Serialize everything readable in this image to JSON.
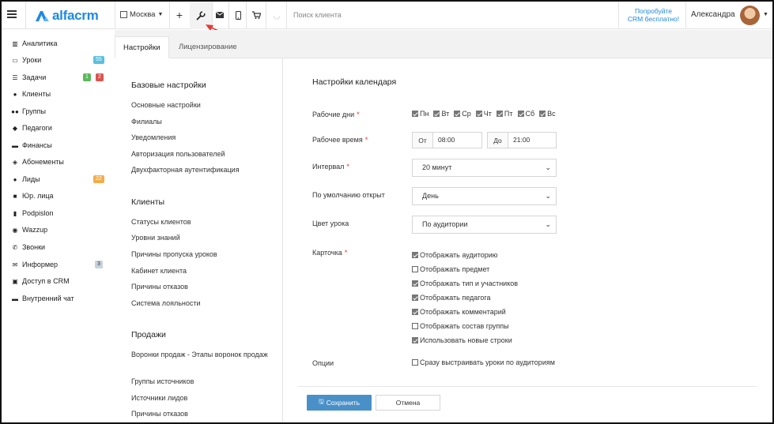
{
  "header": {
    "logo_text": "alfacrm",
    "branch": "Москва",
    "search_placeholder": "Поиск клиента",
    "promo_line1": "Попробуйте",
    "promo_line2": "CRM бесплатно!",
    "user_name": "Александра",
    "icons": [
      "menu-icon",
      "plus-icon",
      "wrench-icon",
      "envelope-icon",
      "mobile-icon",
      "cart-icon"
    ]
  },
  "sidebar": {
    "items": [
      {
        "label": "Аналитика",
        "icon": "chart-icon"
      },
      {
        "label": "Уроки",
        "icon": "calendar-icon",
        "badge": "55",
        "badge_color": "#5bc0de"
      },
      {
        "label": "Задачи",
        "icon": "tasks-icon",
        "badge": "1",
        "badge_color": "#5cb85c",
        "badge2": "2",
        "badge2_color": "#d9534f"
      },
      {
        "label": "Клиенты",
        "icon": "user-icon"
      },
      {
        "label": "Группы",
        "icon": "users-icon"
      },
      {
        "label": "Педагоги",
        "icon": "graduation-cap-icon"
      },
      {
        "label": "Финансы",
        "icon": "money-icon"
      },
      {
        "label": "Абонементы",
        "icon": "tag-icon"
      },
      {
        "label": "Лиды",
        "icon": "user-plus-icon",
        "badge": "22",
        "badge_color": "#f0ad4e"
      },
      {
        "label": "Юр. лица",
        "icon": "briefcase-icon"
      },
      {
        "label": "Podpislon",
        "icon": "file-icon"
      },
      {
        "label": "Wazzup",
        "icon": "whatsapp-icon"
      },
      {
        "label": "Звонки",
        "icon": "phone-icon"
      },
      {
        "label": "Информер",
        "icon": "envelope-icon",
        "badge": "3",
        "badge_color": "#c8d3dc"
      },
      {
        "label": "Доступ в CRM",
        "icon": "lock-icon"
      },
      {
        "label": "Внутренний чат",
        "icon": "chat-icon"
      }
    ]
  },
  "tabs": [
    {
      "label": "Настройки",
      "active": true
    },
    {
      "label": "Лицензирование",
      "active": false
    }
  ],
  "settings_nav": {
    "sections": [
      {
        "title": "Базовые настройки",
        "links": [
          "Основные настройки",
          "Филиалы",
          "Уведомления",
          "Авторизация пользователей",
          "Двухфакторная аутентификация"
        ]
      },
      {
        "title": "Клиенты",
        "links": [
          "Статусы клиентов",
          "Уровни знаний",
          "Причины пропуска уроков",
          "Кабинет клиента",
          "Причины отказов",
          "Система лояльности"
        ]
      },
      {
        "title": "Продажи",
        "links": [
          "Воронки продаж - Этапы воронок продаж",
          "Группы источников",
          "Источники лидов",
          "Причины отказов"
        ]
      }
    ]
  },
  "form": {
    "title": "Настройки календаря",
    "workdays_label": "Рабочие дни",
    "workdays": [
      {
        "label": "Пн",
        "checked": true
      },
      {
        "label": "Вт",
        "checked": true
      },
      {
        "label": "Ср",
        "checked": true
      },
      {
        "label": "Чт",
        "checked": true
      },
      {
        "label": "Пт",
        "checked": true
      },
      {
        "label": "Сб",
        "checked": true
      },
      {
        "label": "Вс",
        "checked": true
      }
    ],
    "worktime_label": "Рабочее время",
    "from_prefix": "От",
    "from_value": "08:00",
    "to_prefix": "До",
    "to_value": "21:00",
    "interval_label": "Интервал",
    "interval_value": "20 минут",
    "default_open_label": "По умолчанию открыт",
    "default_open_value": "День",
    "lesson_color_label": "Цвет урока",
    "lesson_color_value": "По аудитории",
    "card_label": "Карточка",
    "card_options": [
      {
        "label": "Отображать аудиторию",
        "checked": true
      },
      {
        "label": "Отображать предмет",
        "checked": false
      },
      {
        "label": "Отображать тип и участников",
        "checked": true
      },
      {
        "label": "Отображать педагога",
        "checked": true
      },
      {
        "label": "Отображать комментарий",
        "checked": true
      },
      {
        "label": "Отображать состав группы",
        "checked": false
      },
      {
        "label": "Использовать новые строки",
        "checked": true
      }
    ],
    "options_label": "Опции",
    "options_item": {
      "label": "Сразу выстраивать уроки по аудиториям",
      "checked": false
    },
    "save_label": "Сохранить",
    "cancel_label": "Отмена",
    "required_mark": "*"
  },
  "colors": {
    "accent": "#1e88e5",
    "save_button": "#4a90c8",
    "required": "#e53935",
    "annotation_arrow": "#e53935"
  }
}
